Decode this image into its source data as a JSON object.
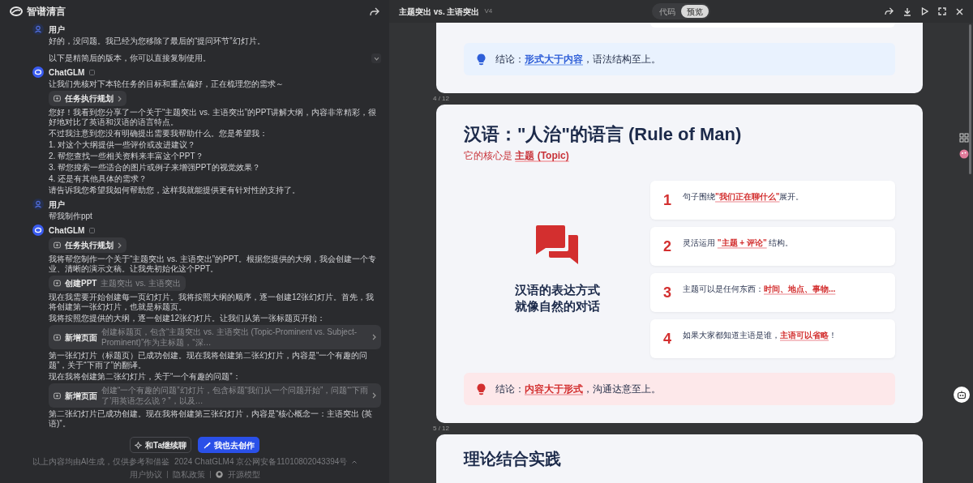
{
  "app": {
    "name": "智谱清言"
  },
  "chat": {
    "messages": [
      {
        "kind": "user",
        "author": "用户",
        "collapsible": true,
        "blocks": [
          {
            "kind": "text",
            "text": "好的，没问题。我已经为您移除了最后的“提问环节”幻灯片。"
          },
          {
            "kind": "gap"
          },
          {
            "kind": "text",
            "text": "以下是精简后的版本，你可以直接复制使用。"
          }
        ]
      },
      {
        "kind": "assistant",
        "author": "ChatGLM",
        "collapsible": false,
        "blocks": [
          {
            "kind": "text",
            "text": "让我们先核对下本轮任务的目标和重点偏好，正在梳理您的需求～"
          },
          {
            "kind": "chip",
            "label": "任务执行规划",
            "chevron": true
          },
          {
            "kind": "text",
            "text": "您好！我看到您分享了一个关于“主题突出 vs. 主语突出”的PPT讲解大纲，内容非常精彩，很好地对比了英语和汉语的语言特点。"
          },
          {
            "kind": "text",
            "text": "不过我注意到您没有明确提出需要我帮助什么。您是希望我："
          },
          {
            "kind": "text",
            "text": "1. 对这个大纲提供一些评价或改进建议？"
          },
          {
            "kind": "text",
            "text": "2. 帮您查找一些相关资料来丰富这个PPT？"
          },
          {
            "kind": "text",
            "text": "3. 帮您搜索一些适合的图片或例子来增强PPT的视觉效果？"
          },
          {
            "kind": "text",
            "text": "4. 还是有其他具体的需求？"
          },
          {
            "kind": "text",
            "text": "请告诉我您希望我如何帮助您，这样我就能提供更有针对性的支持了。"
          }
        ]
      },
      {
        "kind": "user",
        "author": "用户",
        "collapsible": false,
        "blocks": [
          {
            "kind": "text",
            "text": "帮我制作ppt"
          }
        ]
      },
      {
        "kind": "assistant",
        "author": "ChatGLM",
        "collapsible": false,
        "blocks": [
          {
            "kind": "chip",
            "label": "任务执行规划",
            "chevron": true
          },
          {
            "kind": "text",
            "text": "我将帮您制作一个关于“主题突出 vs. 主语突出”的PPT。根据您提供的大纲，我会创建一个专业、清晰的演示文稿。让我先初始化这个PPT。"
          },
          {
            "kind": "chip",
            "label": "创建PPT",
            "detail": "主题突出 vs. 主语突出",
            "chevron": false
          },
          {
            "kind": "text",
            "text": "现在我需要开始创建每一页幻灯片。我将按照大纲的顺序，逐一创建12张幻灯片。首先，我将创建第一张幻灯片，也就是标题页。"
          },
          {
            "kind": "text",
            "text": "我将按照您提供的大纲，逐一创建12张幻灯片。让我们从第一张标题页开始："
          },
          {
            "kind": "chip",
            "label": "新增页面",
            "detail": "创建标题页，包含“主题突出 vs. 主语突出 (Topic-Prominent vs. Subject-Prominent)”作为主标题，“深…",
            "chevron": true
          },
          {
            "kind": "text",
            "text": "第一张幻灯片（标题页）已成功创建。现在我将创建第二张幻灯片，内容是“一个有趣的问题”，关于“下雨了”的翻译。"
          },
          {
            "kind": "text",
            "text": "现在我将创建第二张幻灯片，关于“一个有趣的问题”："
          },
          {
            "kind": "chip",
            "label": "新增页面",
            "detail": "创建“一个有趣的问题”幻灯片，包含标题“我们从一个问题开始”，问题“‘下雨了’用英语怎么说？”，以及…",
            "chevron": true
          },
          {
            "kind": "text",
            "text": "第二张幻灯片已成功创建。现在我将创建第三张幻灯片，内容是“核心概念一：主语突出 (英语)”。"
          }
        ]
      }
    ]
  },
  "footer": {
    "buttons": [
      {
        "label": "和Ta继续聊",
        "kind": "secondary"
      },
      {
        "label": "我也去创作",
        "kind": "primary"
      }
    ],
    "disclaimer": "以上内容均由AI生成，仅供参考和借鉴",
    "copyright": "2024 ChatGLM4 京公网安备11010802043394号",
    "links": [
      "用户协议",
      "隐私政策",
      "开源模型"
    ]
  },
  "preview": {
    "title": "主题突出 vs. 主语突出",
    "version": "V4",
    "view_tabs": [
      {
        "label": "代码",
        "selected": false
      },
      {
        "label": "预览",
        "selected": true
      }
    ],
    "slides": [
      {
        "kind": "partial",
        "conclusion": {
          "kind": "blue",
          "text": "结论：**形式大于内容**，语法结构至上。"
        }
      },
      {
        "kind": "full",
        "page": "4 / 12",
        "title": "汉语：\"人治\"的语言 (Rule of Man)",
        "subtitle": "它的核心是 **主题 (Topic)**",
        "caption_lines": [
          "汉语的表达方式",
          "就像自然的对话"
        ],
        "points": [
          {
            "number": "1",
            "text": "句子围绕**\"我们正在聊什么\"**展开。"
          },
          {
            "number": "2",
            "text": "灵活运用 **\"主题 + 评论\"** 结构。"
          },
          {
            "number": "3",
            "text": "主题可以是任何东西：**时间、地点、事物...**"
          },
          {
            "number": "4",
            "text": "如果大家都知道主语是谁，**主语可以省略**！"
          }
        ],
        "conclusion": {
          "kind": "red",
          "text": "结论：**内容大于形式**，沟通达意至上。"
        }
      },
      {
        "kind": "heading",
        "page": "5 / 12",
        "title": "理论结合实践"
      }
    ]
  }
}
